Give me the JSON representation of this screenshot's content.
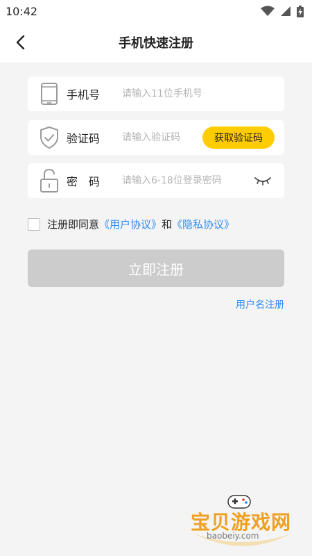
{
  "status_bar": {
    "time": "10:42"
  },
  "header": {
    "title": "手机快速注册"
  },
  "form": {
    "phone": {
      "label": "手机号",
      "placeholder": "请输入11位手机号"
    },
    "code": {
      "label": "验证码",
      "placeholder": "请输入验证码",
      "button": "获取验证码"
    },
    "password": {
      "label": "密　码",
      "placeholder": "请输入6-18位登录密码"
    }
  },
  "agreement": {
    "prefix": "注册即同意",
    "user_agreement": "《用户协议》",
    "and": "和",
    "privacy_agreement": "《隐私协议》"
  },
  "submit": {
    "label": "立即注册"
  },
  "alt_register": {
    "label": "用户名注册"
  },
  "watermark": {
    "title": "宝贝游戏网",
    "url": "baobeiy.com"
  },
  "colors": {
    "accent": "#ffcc00",
    "link": "#2f8cf0",
    "disabled_button": "#cccccc",
    "background": "#f4f4f4"
  },
  "icons": [
    "back-arrow-icon",
    "phone-icon",
    "shield-check-icon",
    "lock-icon",
    "eye-closed-icon",
    "wifi-icon",
    "signal-icon",
    "battery-icon"
  ]
}
